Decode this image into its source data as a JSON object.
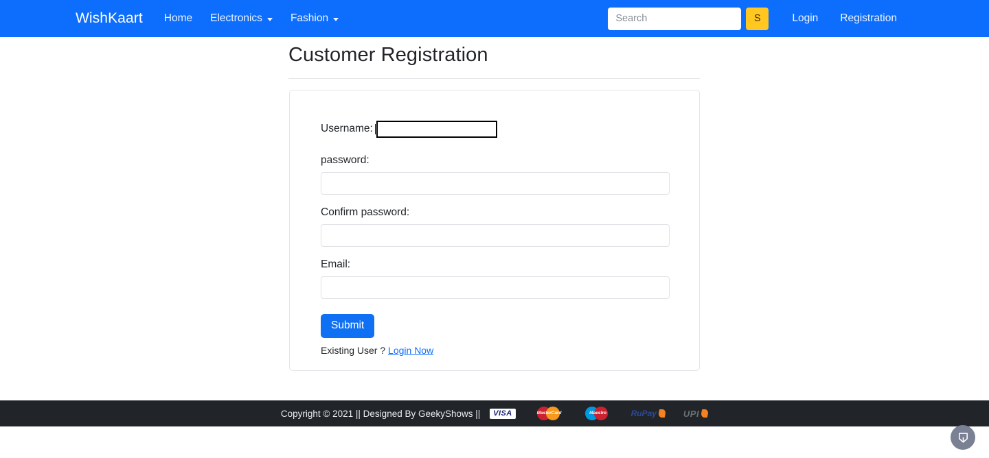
{
  "navbar": {
    "brand": "WishKaart",
    "links": [
      {
        "label": "Home",
        "has_caret": false
      },
      {
        "label": "Electronics",
        "has_caret": true
      },
      {
        "label": "Fashion",
        "has_caret": true
      }
    ],
    "search": {
      "placeholder": "Search",
      "value": "",
      "button_label": "S"
    },
    "auth": [
      {
        "label": "Login"
      },
      {
        "label": "Registration"
      }
    ],
    "background_color": "#0d6efd",
    "search_button_color": "#ffc720"
  },
  "page": {
    "title": "Customer Registration"
  },
  "form": {
    "username": {
      "label": "Username:",
      "value": "",
      "focused": true
    },
    "password": {
      "label": "password:",
      "value": ""
    },
    "confirm_password": {
      "label": "Confirm password:",
      "value": ""
    },
    "email": {
      "label": "Email:",
      "value": ""
    },
    "submit_label": "Submit",
    "existing_user_text": "Existing User ?",
    "login_link_label": "Login Now"
  },
  "footer": {
    "copyright": "Copyright © 2021 || Designed By GeekyShows ||",
    "background_color": "#212529",
    "payment_logos": [
      {
        "name": "visa",
        "label": "VISA"
      },
      {
        "name": "mastercard",
        "label": "MasterCard"
      },
      {
        "name": "maestro",
        "label": "Maestro"
      },
      {
        "name": "rupay",
        "label": "RuPay"
      },
      {
        "name": "upi",
        "label": "UPI"
      }
    ]
  },
  "chat_widget": {
    "icon": "chat-badge-icon",
    "color": "#7a8194"
  }
}
